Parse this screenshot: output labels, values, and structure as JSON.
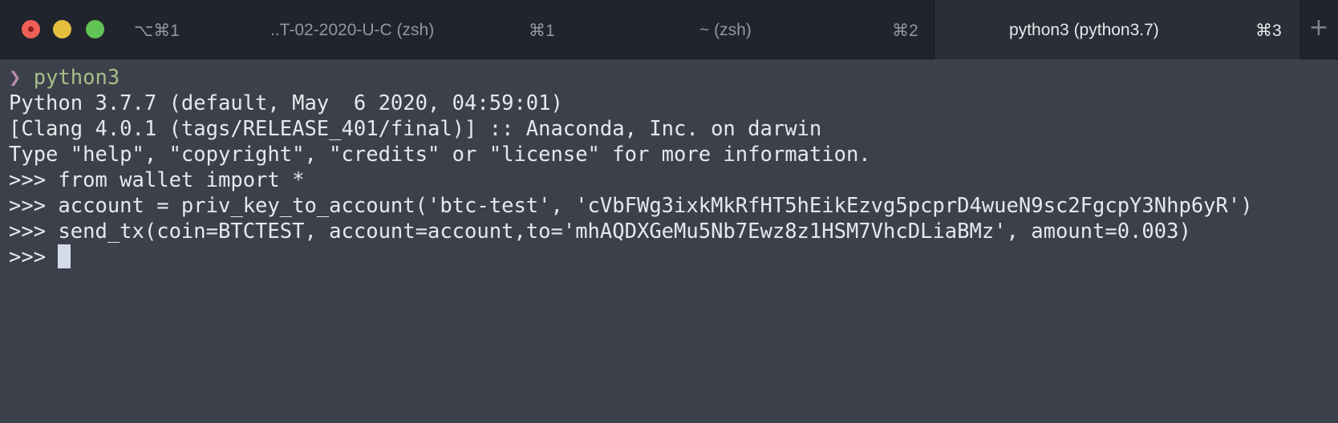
{
  "window": {
    "buttons": [
      "close",
      "minimize",
      "maximize"
    ],
    "colors": {
      "close": "#ee5f57",
      "minimize": "#e6bf3f",
      "maximize": "#61c454"
    }
  },
  "tabs": [
    {
      "label": "",
      "shortcut": "⌥⌘1",
      "active": false
    },
    {
      "label": "..T-02-2020-U-C (zsh)",
      "shortcut": "⌘1",
      "active": false
    },
    {
      "label": "~ (zsh)",
      "shortcut": "⌘2",
      "active": false
    },
    {
      "label": "python3 (python3.7)",
      "shortcut": "⌘3",
      "active": true
    }
  ],
  "new_tab_label": "+",
  "terminal": {
    "shell_prompt": "❯",
    "shell_command": "python3",
    "lines": [
      "Python 3.7.7 (default, May  6 2020, 04:59:01)",
      "[Clang 4.0.1 (tags/RELEASE_401/final)] :: Anaconda, Inc. on darwin",
      "Type \"help\", \"copyright\", \"credits\" or \"license\" for more information.",
      ">>> from wallet import *",
      ">>> account = priv_key_to_account('btc-test', 'cVbFWg3ixkMkRfHT5hEikEzvg5pcprD4wueN9sc2FgcpY3Nhp6yR')",
      ">>> send_tx(coin=BTCTEST, account=account,to='mhAQDXGeMu5Nb7Ewz8z1HSM7VhcDLiaBMz', amount=0.003)"
    ],
    "current_prompt": ">>> "
  }
}
